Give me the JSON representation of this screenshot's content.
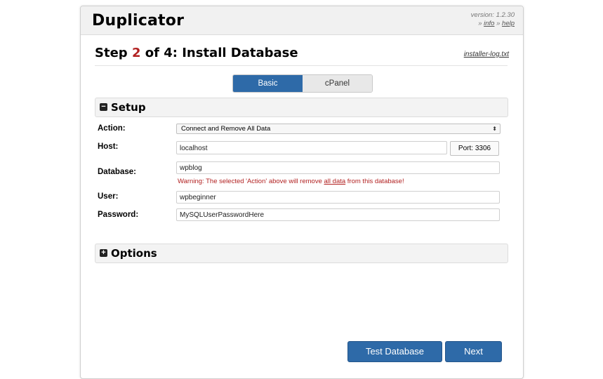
{
  "header": {
    "app_title": "Duplicator",
    "version_text": "version: 1.2.30",
    "link_sep": "»",
    "info_link": "info",
    "help_link": "help"
  },
  "step": {
    "prefix": "Step",
    "number": "2",
    "suffix": "of 4: Install Database",
    "log_link": "installer-log.txt"
  },
  "tabs": [
    {
      "label": "Basic",
      "active": true
    },
    {
      "label": "cPanel",
      "active": false
    }
  ],
  "setup": {
    "title": "Setup",
    "action_label": "Action:",
    "action_value": "Connect and Remove All Data",
    "host_label": "Host:",
    "host_value": "localhost",
    "port_text": "Port: 3306",
    "database_label": "Database:",
    "database_value": "wpblog",
    "warning_pre": "Warning: The selected 'Action' above will remove",
    "warning_link": "all data",
    "warning_post": "from this database!",
    "user_label": "User:",
    "user_value": "wpbeginner",
    "password_label": "Password:",
    "password_value": "MySQLUserPasswordHere"
  },
  "options": {
    "title": "Options"
  },
  "buttons": {
    "test_database": "Test Database",
    "next": "Next"
  },
  "colors": {
    "accent_blue": "#2e6aa8",
    "step_red": "#b22222",
    "warning_red": "#b22222"
  }
}
